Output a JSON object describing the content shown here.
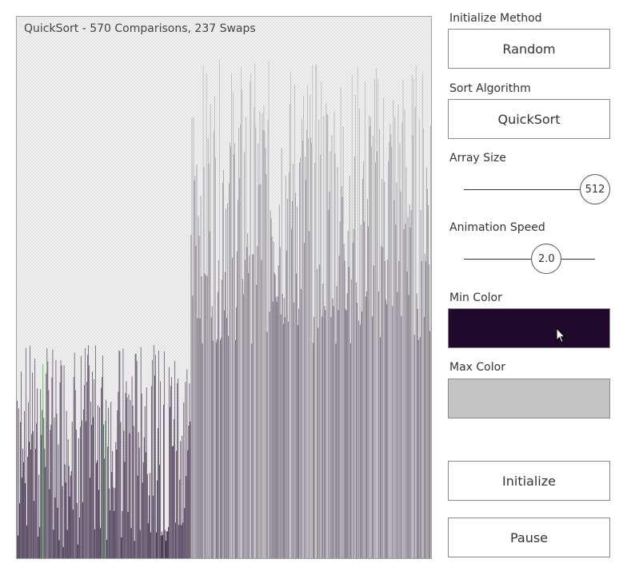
{
  "visualization": {
    "algorithm": "QuickSort",
    "comparisons": 570,
    "swaps": 237,
    "status_text": "QuickSort - 570 Comparisons, 237 Swaps",
    "array_size": 512,
    "sorted_prefix_fraction": 0.42,
    "highlight_indices": [
      32,
      109
    ],
    "highlight_color": "#22cc22",
    "min_color": "#1f0a2e",
    "max_color": "#c4c4c4"
  },
  "controls": {
    "initialize_method": {
      "label": "Initialize Method",
      "value": "Random"
    },
    "sort_algorithm": {
      "label": "Sort Algorithm",
      "value": "QuickSort"
    },
    "array_size": {
      "label": "Array Size",
      "value": "512",
      "fraction": 1.0
    },
    "animation_speed": {
      "label": "Animation Speed",
      "value": "2.0",
      "fraction": 0.63
    },
    "min_color": {
      "label": "Min Color",
      "color": "#1f0a2e"
    },
    "max_color": {
      "label": "Max Color",
      "color": "#c4c4c4"
    },
    "initialize_button": "Initialize",
    "pause_button": "Pause"
  }
}
